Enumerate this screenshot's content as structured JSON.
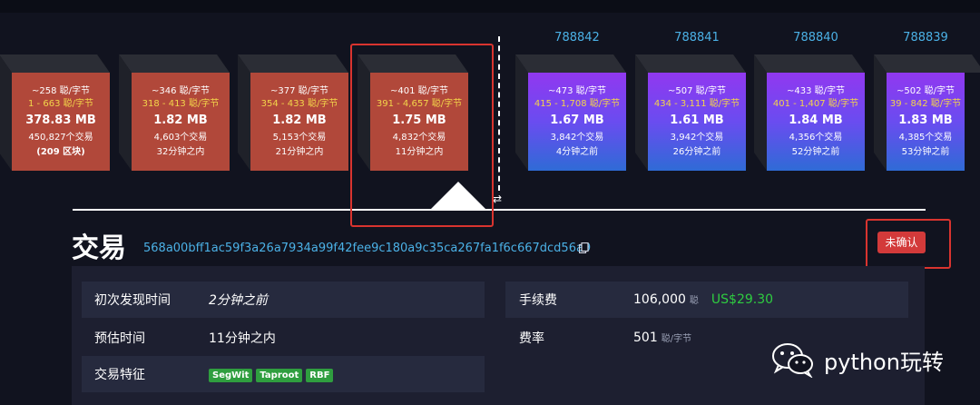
{
  "blocks": [
    {
      "fee": "~258 聪/字节",
      "range": "1 - 663 聪/字节",
      "size": "378.83 MB",
      "count": "450,827个交易",
      "time": "(209 区块)",
      "height": "",
      "kind": "mined",
      "time_bold": true
    },
    {
      "fee": "~346 聪/字节",
      "range": "318 - 413 聪/字节",
      "size": "1.82 MB",
      "count": "4,603个交易",
      "time": "32分钟之内",
      "height": "",
      "kind": "mined"
    },
    {
      "fee": "~377 聪/字节",
      "range": "354 - 433 聪/字节",
      "size": "1.82 MB",
      "count": "5,153个交易",
      "time": "21分钟之内",
      "height": "",
      "kind": "mined"
    },
    {
      "fee": "~401 聪/字节",
      "range": "391 - 4,657 聪/字节",
      "size": "1.75 MB",
      "count": "4,832个交易",
      "time": "11分钟之内",
      "height": "",
      "kind": "mined"
    },
    {
      "fee": "~473 聪/字节",
      "range": "415 - 1,708 聪/字节",
      "size": "1.67 MB",
      "count": "3,842个交易",
      "time": "4分钟之前",
      "height": "788842",
      "kind": "pending"
    },
    {
      "fee": "~507 聪/字节",
      "range": "434 - 3,111 聪/字节",
      "size": "1.61 MB",
      "count": "3,942个交易",
      "time": "26分钟之前",
      "height": "788841",
      "kind": "pending"
    },
    {
      "fee": "~433 聪/字节",
      "range": "401 - 1,407 聪/字节",
      "size": "1.84 MB",
      "count": "4,356个交易",
      "time": "52分钟之前",
      "height": "788840",
      "kind": "pending"
    },
    {
      "fee": "~502 聪/字节",
      "range": "39 - 842 聪/字节",
      "size": "1.83 MB",
      "count": "4,385个交易",
      "time": "53分钟之前",
      "height": "788839",
      "kind": "pending"
    }
  ],
  "tx": {
    "title": "交易",
    "hash": "568a00bff1ac59f3a26a7934a99f42fee9c180a9c35ca267fa1f6c667dcd56a9",
    "status": "未确认"
  },
  "details": {
    "first_seen_label": "初次发现时间",
    "first_seen_value": "2分钟之前",
    "eta_label": "预估时间",
    "eta_value": "11分钟之内",
    "features_label": "交易特征",
    "features": [
      "SegWit",
      "Taproot",
      "RBF"
    ],
    "fee_label": "手续费",
    "fee_value": "106,000",
    "fee_unit": "聪",
    "fee_usd": "US$29.30",
    "rate_label": "费率",
    "rate_value": "501",
    "rate_unit": "聪/字节"
  },
  "watermark": {
    "text": "python玩转"
  },
  "colors": {
    "accent": "#4bb1e6",
    "mined": "#b1483a",
    "status": "#d33a3a",
    "tag": "#2f9e3f",
    "usd": "#2ecc40"
  }
}
